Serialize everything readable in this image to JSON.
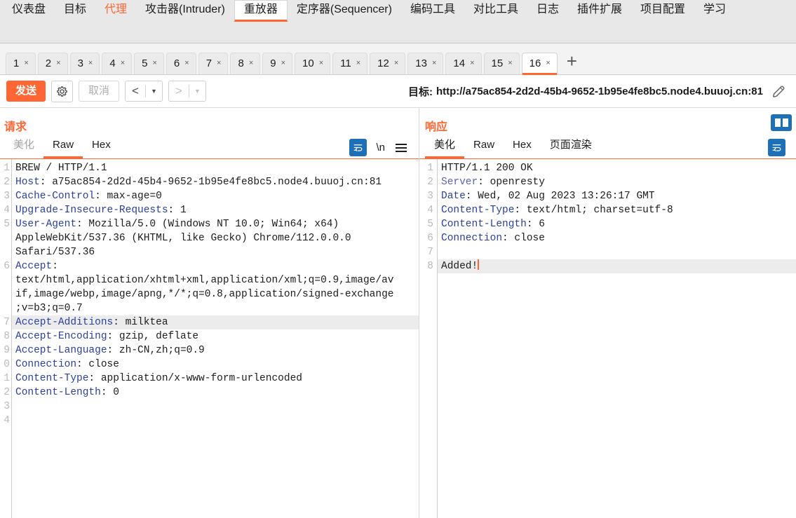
{
  "topnav": {
    "items": [
      {
        "label": "仪表盘",
        "state": "normal"
      },
      {
        "label": "目标",
        "state": "normal"
      },
      {
        "label": "代理",
        "state": "accent"
      },
      {
        "label": "攻击器(Intruder)",
        "state": "normal"
      },
      {
        "label": "重放器",
        "state": "selected"
      },
      {
        "label": "定序器(Sequencer)",
        "state": "normal"
      },
      {
        "label": "编码工具",
        "state": "normal"
      },
      {
        "label": "对比工具",
        "state": "normal"
      },
      {
        "label": "日志",
        "state": "normal"
      },
      {
        "label": "插件扩展",
        "state": "normal"
      },
      {
        "label": "项目配置",
        "state": "normal"
      },
      {
        "label": "学习",
        "state": "normal"
      }
    ]
  },
  "tabstrip": {
    "tabs": [
      {
        "label": "1",
        "close": "×",
        "selected": false
      },
      {
        "label": "2",
        "close": "×",
        "selected": false
      },
      {
        "label": "3",
        "close": "×",
        "selected": false
      },
      {
        "label": "4",
        "close": "×",
        "selected": false
      },
      {
        "label": "5",
        "close": "×",
        "selected": false
      },
      {
        "label": "6",
        "close": "×",
        "selected": false
      },
      {
        "label": "7",
        "close": "×",
        "selected": false
      },
      {
        "label": "8",
        "close": "×",
        "selected": false
      },
      {
        "label": "9",
        "close": "×",
        "selected": false
      },
      {
        "label": "10",
        "close": "×",
        "selected": false
      },
      {
        "label": "11",
        "close": "×",
        "selected": false
      },
      {
        "label": "12",
        "close": "×",
        "selected": false
      },
      {
        "label": "13",
        "close": "×",
        "selected": false
      },
      {
        "label": "14",
        "close": "×",
        "selected": false
      },
      {
        "label": "15",
        "close": "×",
        "selected": false
      },
      {
        "label": "16",
        "close": "×",
        "selected": true
      }
    ],
    "add_label": "+"
  },
  "toolbar": {
    "send_label": "发送",
    "settings_icon": "gear-icon",
    "cancel_label": "取消",
    "back_arrow": "<",
    "back_caret": "▼",
    "forward_arrow": ">",
    "forward_caret": "▼",
    "target_prefix": "目标:",
    "target_url": "http://a75ac854-2d2d-45b4-9652-1b95e4fe8bc5.node4.buuoj.cn:81",
    "edit_icon": "pencil-icon"
  },
  "request": {
    "title": "请求",
    "tabs": [
      {
        "label": "美化",
        "selected": false,
        "muted": true
      },
      {
        "label": "Raw",
        "selected": true,
        "muted": false
      },
      {
        "label": "Hex",
        "selected": false,
        "muted": false
      }
    ],
    "wrap_icon": "word-wrap-icon",
    "newline_label": "\\n",
    "menu_icon": "hamburger-menu-icon",
    "gutter": [
      "1",
      "2",
      "3",
      "4",
      "5",
      "",
      "",
      "6",
      "",
      "",
      "",
      "7",
      "8",
      "9",
      "0",
      "1",
      "2",
      "3",
      "4"
    ],
    "lines": [
      {
        "text": "BREW / HTTP/1.1",
        "highlight": false,
        "name": null
      },
      {
        "text": "Host: a75ac854-2d2d-45b4-9652-1b95e4fe8bc5.node4.buuoj.cn:81",
        "highlight": false,
        "name": "Host"
      },
      {
        "text": "Cache-Control: max-age=0",
        "highlight": false,
        "name": "Cache-Control"
      },
      {
        "text": "Upgrade-Insecure-Requests: 1",
        "highlight": false,
        "name": "Upgrade-Insecure-Requests"
      },
      {
        "text": "User-Agent: Mozilla/5.0 (Windows NT 10.0; Win64; x64)",
        "highlight": false,
        "name": "User-Agent"
      },
      {
        "text": "AppleWebKit/537.36 (KHTML, like Gecko) Chrome/112.0.0.0",
        "highlight": false,
        "name": null
      },
      {
        "text": "Safari/537.36",
        "highlight": false,
        "name": null
      },
      {
        "text": "Accept:",
        "highlight": false,
        "name": "Accept"
      },
      {
        "text": "text/html,application/xhtml+xml,application/xml;q=0.9,image/av",
        "highlight": false,
        "name": null
      },
      {
        "text": "if,image/webp,image/apng,*/*;q=0.8,application/signed-exchange",
        "highlight": false,
        "name": null
      },
      {
        "text": ";v=b3;q=0.7",
        "highlight": false,
        "name": null
      },
      {
        "text": "Accept-Additions: milktea",
        "highlight": true,
        "name": "Accept-Additions"
      },
      {
        "text": "Accept-Encoding: gzip, deflate",
        "highlight": false,
        "name": "Accept-Encoding"
      },
      {
        "text": "Accept-Language: zh-CN,zh;q=0.9",
        "highlight": false,
        "name": "Accept-Language"
      },
      {
        "text": "Connection: close",
        "highlight": false,
        "name": "Connection"
      },
      {
        "text": "Content-Type: application/x-www-form-urlencoded",
        "highlight": false,
        "name": "Content-Type"
      },
      {
        "text": "Content-Length: 0",
        "highlight": false,
        "name": "Content-Length"
      },
      {
        "text": "",
        "highlight": false,
        "name": null
      },
      {
        "text": "",
        "highlight": false,
        "name": null
      }
    ]
  },
  "response": {
    "title": "响应",
    "tabs": [
      {
        "label": "美化",
        "selected": true,
        "muted": false
      },
      {
        "label": "Raw",
        "selected": false,
        "muted": false
      },
      {
        "label": "Hex",
        "selected": false,
        "muted": false
      },
      {
        "label": "页面渲染",
        "selected": false,
        "muted": false
      }
    ],
    "layout_icon": "split-layout-icon",
    "wrap_icon": "word-wrap-icon",
    "gutter": [
      "1",
      "2",
      "3",
      "4",
      "5",
      "6",
      "7",
      "8"
    ],
    "lines": [
      {
        "text": "HTTP/1.1 200 OK",
        "highlight": false,
        "name": null
      },
      {
        "text": "Server: openresty",
        "highlight": false,
        "name": "Server",
        "lightname": true
      },
      {
        "text": "Date: Wed, 02 Aug 2023 13:26:17 GMT",
        "highlight": false,
        "name": "Date"
      },
      {
        "text": "Content-Type: text/html; charset=utf-8",
        "highlight": false,
        "name": "Content-Type"
      },
      {
        "text": "Content-Length: 6",
        "highlight": false,
        "name": "Content-Length"
      },
      {
        "text": "Connection: close",
        "highlight": false,
        "name": "Connection"
      },
      {
        "text": "",
        "highlight": false,
        "name": null
      },
      {
        "text": "Added!",
        "highlight": true,
        "name": null,
        "caret": true
      }
    ]
  },
  "colors": {
    "accent": "#ff6633",
    "header_name": "#2a3fa0",
    "icon_blue": "#1d6fb8",
    "nav_bg": "#e8e8e8"
  }
}
